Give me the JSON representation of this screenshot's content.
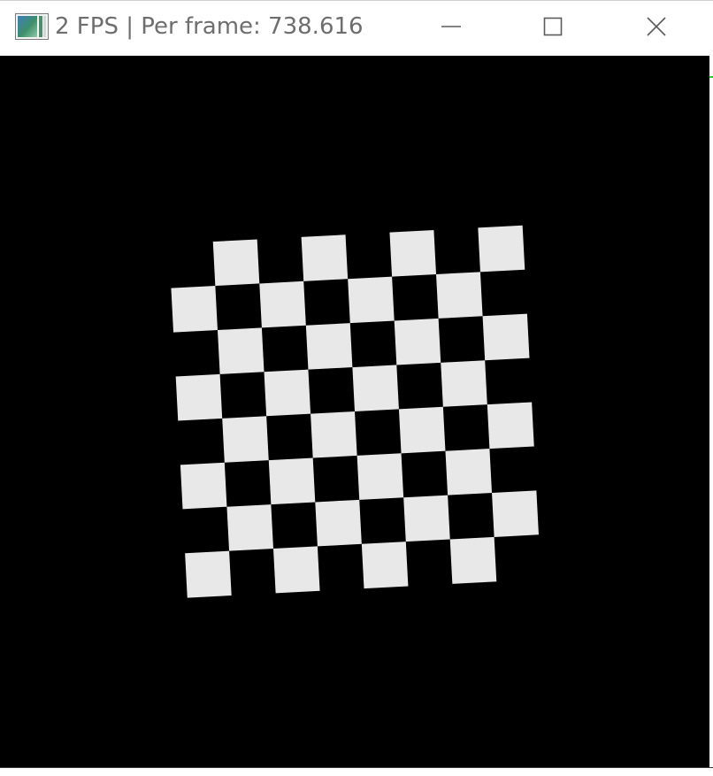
{
  "window": {
    "title": "2 FPS | Per frame: 738.616",
    "controls": {
      "minimize_icon": "minimize-icon",
      "maximize_icon": "maximize-icon",
      "close_icon": "close-icon"
    }
  },
  "scene": {
    "background_color": "#000000",
    "board": {
      "rows": 8,
      "cols": 8,
      "light_color": "#e8e8e8",
      "dark_color": "#000000",
      "rotation_deg": -3
    }
  }
}
